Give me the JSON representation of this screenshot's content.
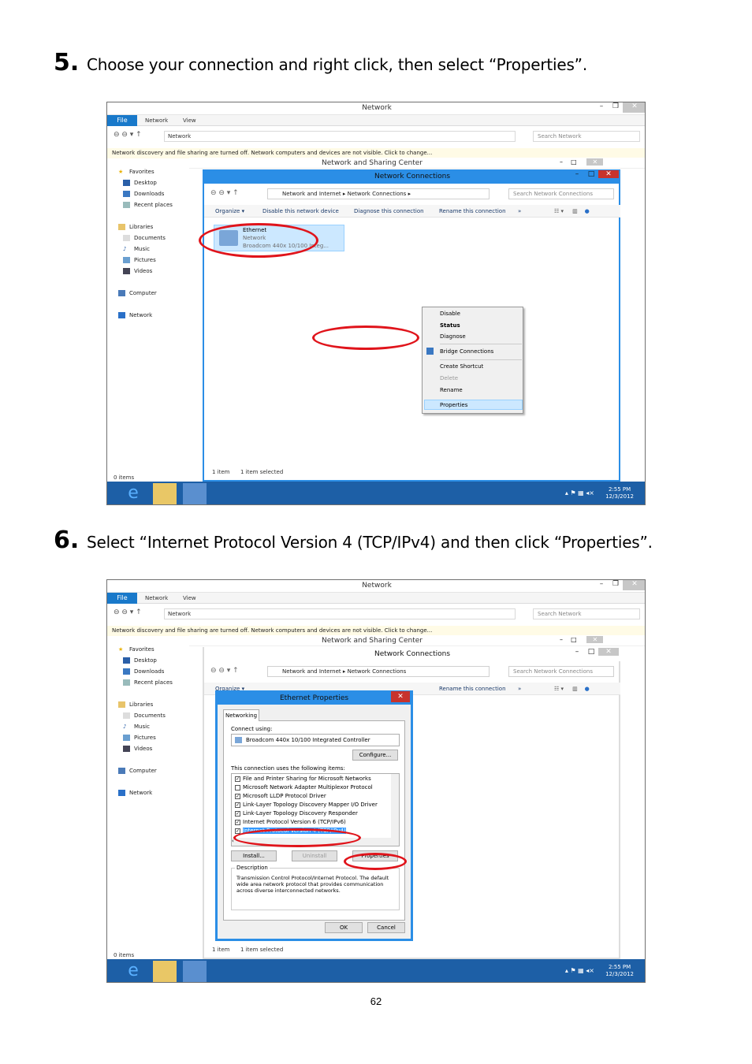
{
  "steps": [
    {
      "num": "5.",
      "text": "Choose your connection and right click, then select “Properties”."
    },
    {
      "num": "6.",
      "text": "Select “Internet Protocol Version 4 (TCP/IPv4) and then click “Properties”."
    }
  ],
  "page_number": "62",
  "explorer": {
    "title": "Network",
    "ribbon_tabs": [
      "File",
      "Network",
      "View"
    ],
    "address": "Network",
    "search_placeholder": "Search Network",
    "notice": "Network discovery and file sharing are turned off. Network computers and devices are not visible. Click to change...",
    "nav_items": [
      "Favorites",
      "Desktop",
      "Downloads",
      "Recent places",
      "Libraries",
      "Documents",
      "Music",
      "Pictures",
      "Videos",
      "Computer",
      "Network"
    ],
    "status_items": "0 items",
    "clock_time": "2:55 PM",
    "clock_date": "12/3/2012"
  },
  "nsc": {
    "title": "Network and Sharing Center"
  },
  "nc": {
    "title": "Network Connections",
    "breadcrumb": [
      "Network and Internet",
      "Network Connections"
    ],
    "search_placeholder": "Search Network Connections",
    "commands": [
      "Organize ▾",
      "Disable this network device",
      "Diagnose this connection",
      "Rename this connection",
      "»"
    ],
    "status_count": "1 item",
    "status_selected": "1 item selected",
    "adapter": {
      "name": "Ethernet",
      "network": "Network",
      "device": "Broadcom 440x 10/100 Integ..."
    }
  },
  "context_menu": [
    "Disable",
    "Status",
    "Diagnose",
    "Bridge Connections",
    "Create Shortcut",
    "Delete",
    "Rename",
    "Properties"
  ],
  "dialog": {
    "title": "Ethernet Properties",
    "tab": "Networking",
    "connect_using": "Connect using:",
    "adapter": "Broadcom 440x 10/100 Integrated Controller",
    "configure": "Configure...",
    "items_label": "This connection uses the following items:",
    "items": [
      {
        "label": "File and Printer Sharing for Microsoft Networks",
        "checked": true
      },
      {
        "label": "Microsoft Network Adapter Multiplexor Protocol",
        "checked": false
      },
      {
        "label": "Microsoft LLDP Protocol Driver",
        "checked": true
      },
      {
        "label": "Link-Layer Topology Discovery Mapper I/O Driver",
        "checked": true
      },
      {
        "label": "Link-Layer Topology Discovery Responder",
        "checked": true
      },
      {
        "label": "Internet Protocol Version 6 (TCP/IPv6)",
        "checked": true
      },
      {
        "label": "Internet Protocol Version 4 (TCP/IPv4)",
        "checked": true
      }
    ],
    "install": "Install...",
    "uninstall": "Uninstall",
    "properties": "Properties",
    "description_label": "Description",
    "description": "Transmission Control Protocol/Internet Protocol. The default wide area network protocol that provides communication across diverse interconnected networks.",
    "ok": "OK",
    "cancel": "Cancel"
  },
  "colors": {
    "accent": "#2b8ee6",
    "highlight": "#e0141b",
    "taskbar": "#1d5fa6"
  }
}
